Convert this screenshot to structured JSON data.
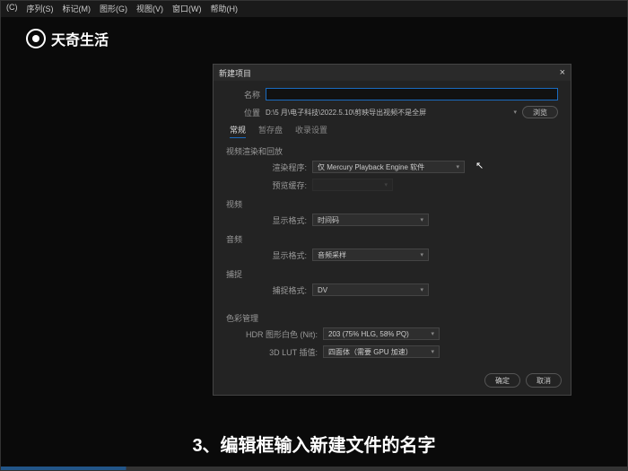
{
  "menu": {
    "items": [
      "(C)",
      "序列(S)",
      "标记(M)",
      "图形(G)",
      "视图(V)",
      "窗口(W)",
      "帮助(H)"
    ]
  },
  "logo_text": "天奇生活",
  "dialog": {
    "title": "新建项目",
    "name_label": "名称",
    "loc_label": "位置",
    "loc_value": "D:\\5 月\\电子科技\\2022.5.10\\剪映导出视频不是全屏",
    "browse": "浏览",
    "tabs": [
      "常规",
      "暂存盘",
      "收录设置"
    ],
    "render_section": "视频渲染和回放",
    "render_label": "渲染程序:",
    "render_value": "仅 Mercury Playback Engine 软件",
    "preview_label": "预览缓存:",
    "video_section": "视频",
    "display_fmt_label": "显示格式:",
    "video_fmt": "时间码",
    "audio_section": "音频",
    "audio_fmt": "音频采样",
    "capture_section": "捕捉",
    "capture_fmt_label": "捕捉格式:",
    "capture_fmt": "DV",
    "color_section": "色彩管理",
    "hdr_label": "HDR 图形白色 (Nit):",
    "hdr_value": "203 (75% HLG, 58% PQ)",
    "lut_label": "3D LUT 插值:",
    "lut_value": "四面体（需要 GPU 加速）",
    "ok": "确定",
    "cancel": "取消"
  },
  "caption": "3、编辑框输入新建文件的名字"
}
